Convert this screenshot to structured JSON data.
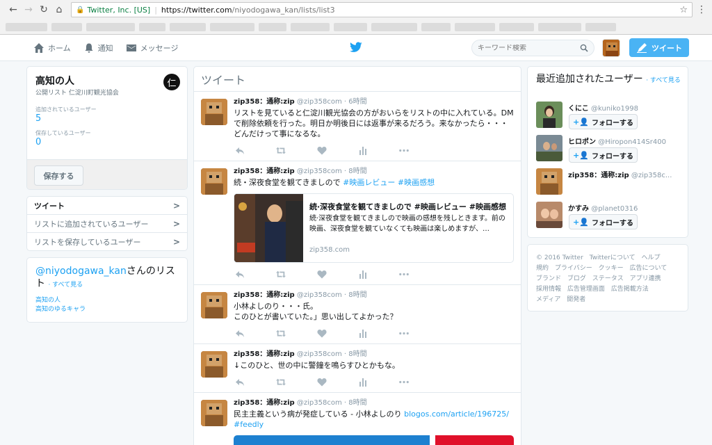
{
  "browser": {
    "site_identity": "Twitter, Inc. [US]",
    "url_host": "https://twitter.com",
    "url_path": "/niyodogawa_kan/lists/list3"
  },
  "topnav": {
    "home": "ホーム",
    "notifications": "通知",
    "messages": "メッセージ",
    "search_placeholder": "キーワード検索",
    "tweet_button": "ツイート"
  },
  "list": {
    "title": "高知の人",
    "subtitle": "公開リスト 仁淀川町観光協会",
    "badge": "仁",
    "members_label": "追加されているユーザー",
    "members_count": "5",
    "subscribers_label": "保存しているユーザー",
    "subscribers_count": "0",
    "save_button": "保存する"
  },
  "list_menu": [
    {
      "label": "ツイート"
    },
    {
      "label": "リストに追加されているユーザー"
    },
    {
      "label": "リストを保存しているユーザー"
    }
  ],
  "owner_lists": {
    "handle": "@niyodogawa_kan",
    "suffix": "さんのリスト",
    "see_all": "· すべて見る",
    "items": [
      "高知の人",
      "高知のゆるキャラ"
    ]
  },
  "timeline": {
    "header": "ツイート",
    "tweets": [
      {
        "name": "zip358：通称:zip",
        "handle": "@zip358com",
        "time": "· 6時間",
        "text": "リストを見ていると仁淀川観光協会の方がおいらをリストの中に入れている。DMで削除依頼を行った。明日か明後日には返事が来るだろう。来なかったら・・・どんだけって事になるな。"
      },
      {
        "name": "zip358：通称:zip",
        "handle": "@zip358com",
        "time": "· 8時間",
        "text": "続・深夜食堂を観てきましので ",
        "hashtags": "#映画レビュー #映画感想",
        "card": {
          "title": "続·深夜食堂を観てきましので #映画レビュー #映画感想",
          "description": "続·深夜食堂を観てきましので映画の感想を残しときます。前の映画、深夜食堂を観ていなくても映画は楽しめますが、…",
          "domain": "zip358.com"
        }
      },
      {
        "name": "zip358：通称:zip",
        "handle": "@zip358com",
        "time": "· 8時間",
        "text": "小林よしのり・・・氏。\nこのひとが書いていた。」思い出してよかった？"
      },
      {
        "name": "zip358：通称:zip",
        "handle": "@zip358com",
        "time": "· 8時間",
        "text": "↓このひと、世の中に警鐘を鳴らすひとかもな。"
      },
      {
        "name": "zip358：通称:zip",
        "handle": "@zip358com",
        "time": "· 8時間",
        "text": "民主主義という病が発症している - 小林よしのり ",
        "link": "blogos.com/article/196725/",
        "hashtag2": "#feedly"
      }
    ]
  },
  "recent_users": {
    "title": "最近追加されたユーザー",
    "see_all": "· すべて見る",
    "follow_label": "フォローする",
    "users": [
      {
        "name": "くにこ",
        "handle": "@kuniko1998"
      },
      {
        "name": "ヒロポン",
        "handle": "@Hiropon414Sr400"
      },
      {
        "name": "zip358：通称:zip",
        "handle": "@zip358c..."
      },
      {
        "name": "かすみ",
        "handle": "@planet0316"
      }
    ]
  },
  "footer": {
    "links": [
      "© 2016 Twitter",
      "Twitterについて",
      "ヘルプ",
      "規約",
      "プライバシー",
      "クッキー",
      "広告について",
      "ブランド",
      "ブログ",
      "ステータス",
      "アプリ連携",
      "採用情報",
      "広告管理画面",
      "広告掲載方法",
      "メディア",
      "開発者"
    ]
  }
}
